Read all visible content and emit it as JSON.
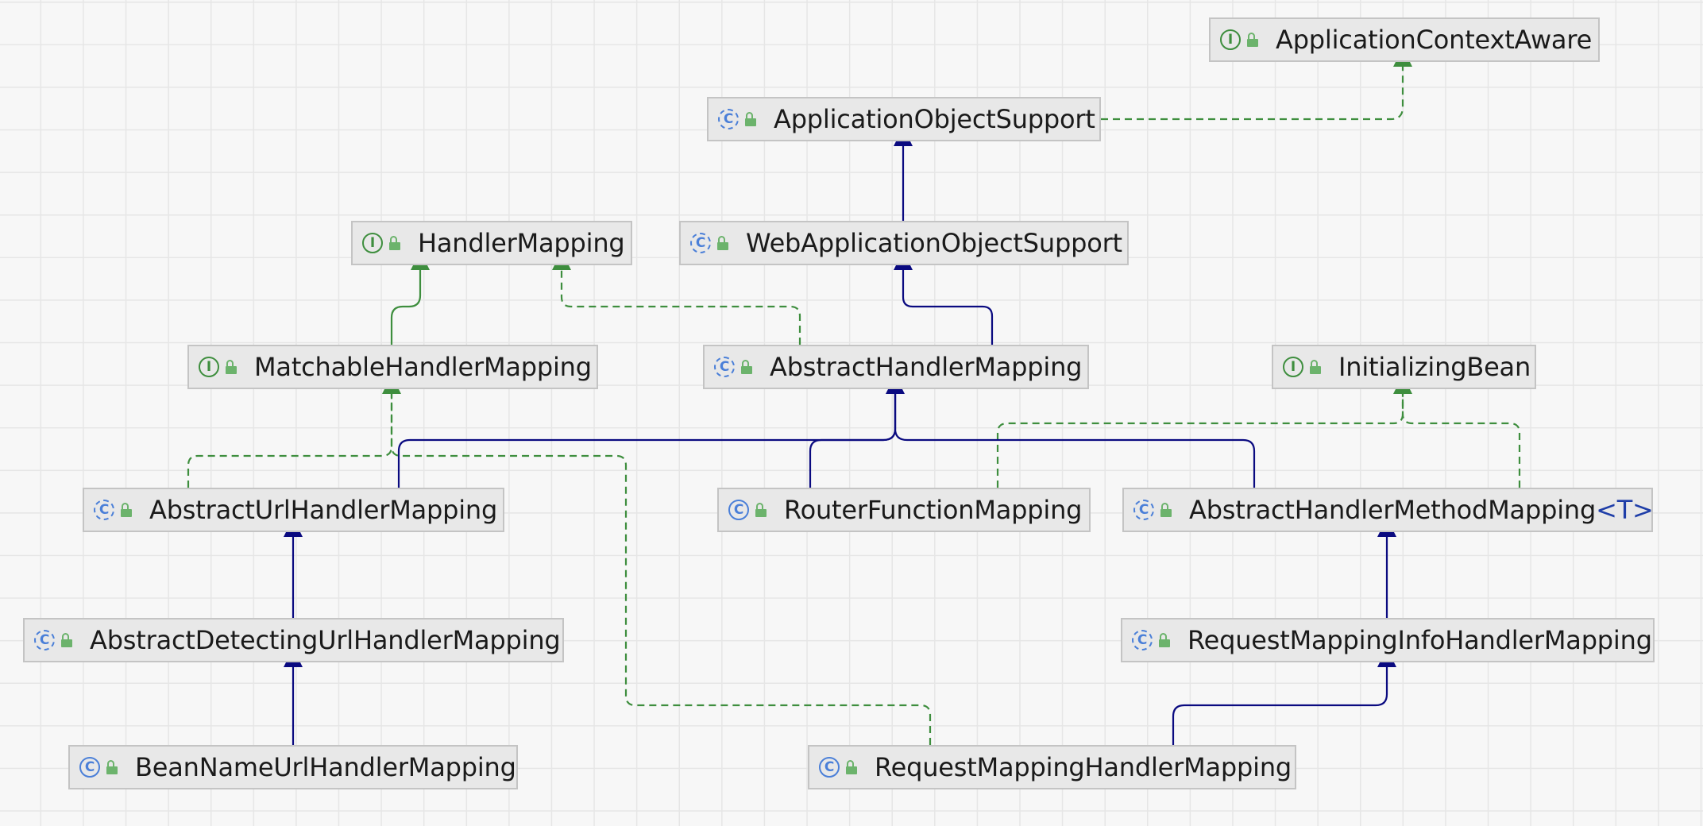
{
  "diagram": {
    "nodes": [
      {
        "id": "aca",
        "kind": "interface",
        "label": "ApplicationContextAware"
      },
      {
        "id": "aos",
        "kind": "abstract-class",
        "label": "ApplicationObjectSupport"
      },
      {
        "id": "hm",
        "kind": "interface",
        "label": "HandlerMapping"
      },
      {
        "id": "waos",
        "kind": "abstract-class",
        "label": "WebApplicationObjectSupport"
      },
      {
        "id": "mhm",
        "kind": "interface",
        "label": "MatchableHandlerMapping"
      },
      {
        "id": "ahm",
        "kind": "abstract-class",
        "label": "AbstractHandlerMapping"
      },
      {
        "id": "ib",
        "kind": "interface",
        "label": "InitializingBean"
      },
      {
        "id": "auhm",
        "kind": "abstract-class",
        "label": "AbstractUrlHandlerMapping"
      },
      {
        "id": "rfm",
        "kind": "class",
        "label": "RouterFunctionMapping"
      },
      {
        "id": "ahmm",
        "kind": "abstract-class",
        "label": "AbstractHandlerMethodMapping",
        "type_param": "<T>"
      },
      {
        "id": "aduhm",
        "kind": "abstract-class",
        "label": "AbstractDetectingUrlHandlerMapping"
      },
      {
        "id": "rmihm",
        "kind": "abstract-class",
        "label": "RequestMappingInfoHandlerMapping"
      },
      {
        "id": "bnuhm",
        "kind": "class",
        "label": "BeanNameUrlHandlerMapping"
      },
      {
        "id": "rmhm",
        "kind": "class",
        "label": "RequestMappingHandlerMapping"
      }
    ],
    "edges": [
      {
        "from": "aos",
        "to": "aca",
        "type": "implements"
      },
      {
        "from": "waos",
        "to": "aos",
        "type": "extends"
      },
      {
        "from": "mhm",
        "to": "hm",
        "type": "extends-interface"
      },
      {
        "from": "ahm",
        "to": "hm",
        "type": "implements"
      },
      {
        "from": "ahm",
        "to": "waos",
        "type": "extends"
      },
      {
        "from": "auhm",
        "to": "mhm",
        "type": "implements"
      },
      {
        "from": "auhm",
        "to": "ahm",
        "type": "extends"
      },
      {
        "from": "rfm",
        "to": "ahm",
        "type": "extends"
      },
      {
        "from": "rfm",
        "to": "ib",
        "type": "implements"
      },
      {
        "from": "ahmm",
        "to": "ahm",
        "type": "extends"
      },
      {
        "from": "ahmm",
        "to": "ib",
        "type": "implements"
      },
      {
        "from": "aduhm",
        "to": "auhm",
        "type": "extends"
      },
      {
        "from": "bnuhm",
        "to": "aduhm",
        "type": "extends"
      },
      {
        "from": "rmihm",
        "to": "ahmm",
        "type": "extends"
      },
      {
        "from": "rmhm",
        "to": "rmihm",
        "type": "extends"
      },
      {
        "from": "rmhm",
        "to": "mhm",
        "type": "implements"
      }
    ],
    "colors": {
      "extends": "#0a0a80",
      "implements": "#3e8e3e",
      "node_fill": "#e8e8e8",
      "node_border": "#c4c4c4",
      "interface_badge": "#3e8e3e",
      "class_badge": "#4a7fd8",
      "access_lock": "#6cb36c",
      "type_param": "#1f3ea8"
    },
    "icons": {
      "interface": "interface-icon",
      "class": "class-icon",
      "abstract-class": "abstract-class-icon",
      "access": "public-access-icon"
    },
    "badge_letters": {
      "interface": "I",
      "class": "C"
    }
  }
}
